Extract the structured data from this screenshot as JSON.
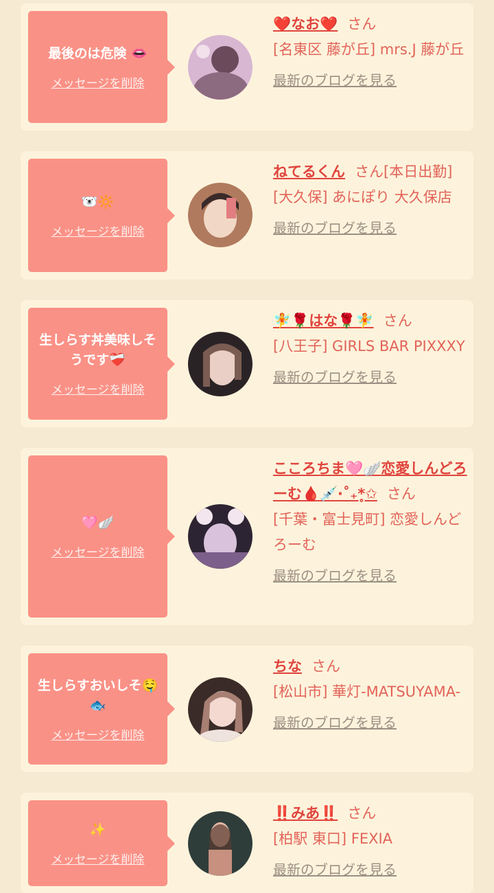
{
  "delete_label": "メッセージを削除",
  "blog_label": "最新のブログを見る",
  "san_label": "さん",
  "cards": [
    {
      "message": "最後のは危険 👄",
      "name": "❤️なお❤️",
      "san_suffix": "",
      "shop": "[名東区 藤が丘] mrs.J 藤が丘",
      "avatar_colors": [
        "#6b4a5c",
        "#d7b7d2",
        "#f2e0ea"
      ]
    },
    {
      "message": "🐻‍❄️🔆",
      "name": "ねてるくん",
      "san_suffix": "[本日出勤]",
      "shop": "[大久保] あにぽり 大久保店",
      "avatar_colors": [
        "#b07a5e",
        "#f1d8c6",
        "#e27d80"
      ]
    },
    {
      "message": "生しらす丼美味しそうです❤️‍🩹",
      "name": "🧚🌹はな🌹🧚",
      "san_suffix": "",
      "shop": "[八王子] GIRLS BAR PIXXXY",
      "avatar_colors": [
        "#2a2326",
        "#e9cfc6",
        "#7a5c52"
      ]
    },
    {
      "message": "🩷🪽",
      "name": "こころちま🩷🪽恋愛しんどろーむ🩸💉‧˚₊*̥✩",
      "san_suffix": "",
      "shop": "[千葉・富士見町] 恋愛しんどろーむ",
      "avatar_colors": [
        "#2d2433",
        "#d9c2dc",
        "#7c5f8a"
      ]
    },
    {
      "message": "生しらすおいしそ🤤🐟",
      "name": "ちな",
      "san_suffix": "",
      "shop": "[松山市] 華灯-MATSUYAMA-",
      "avatar_colors": [
        "#3b2b28",
        "#f3d9cf",
        "#a78073"
      ]
    },
    {
      "message": "✨",
      "name": "‼️みあ‼️",
      "san_suffix": "",
      "shop": "[柏駅 東口] FEXIA",
      "avatar_colors": [
        "#2f3d3a",
        "#e2b8a6",
        "#c7907f"
      ]
    }
  ]
}
